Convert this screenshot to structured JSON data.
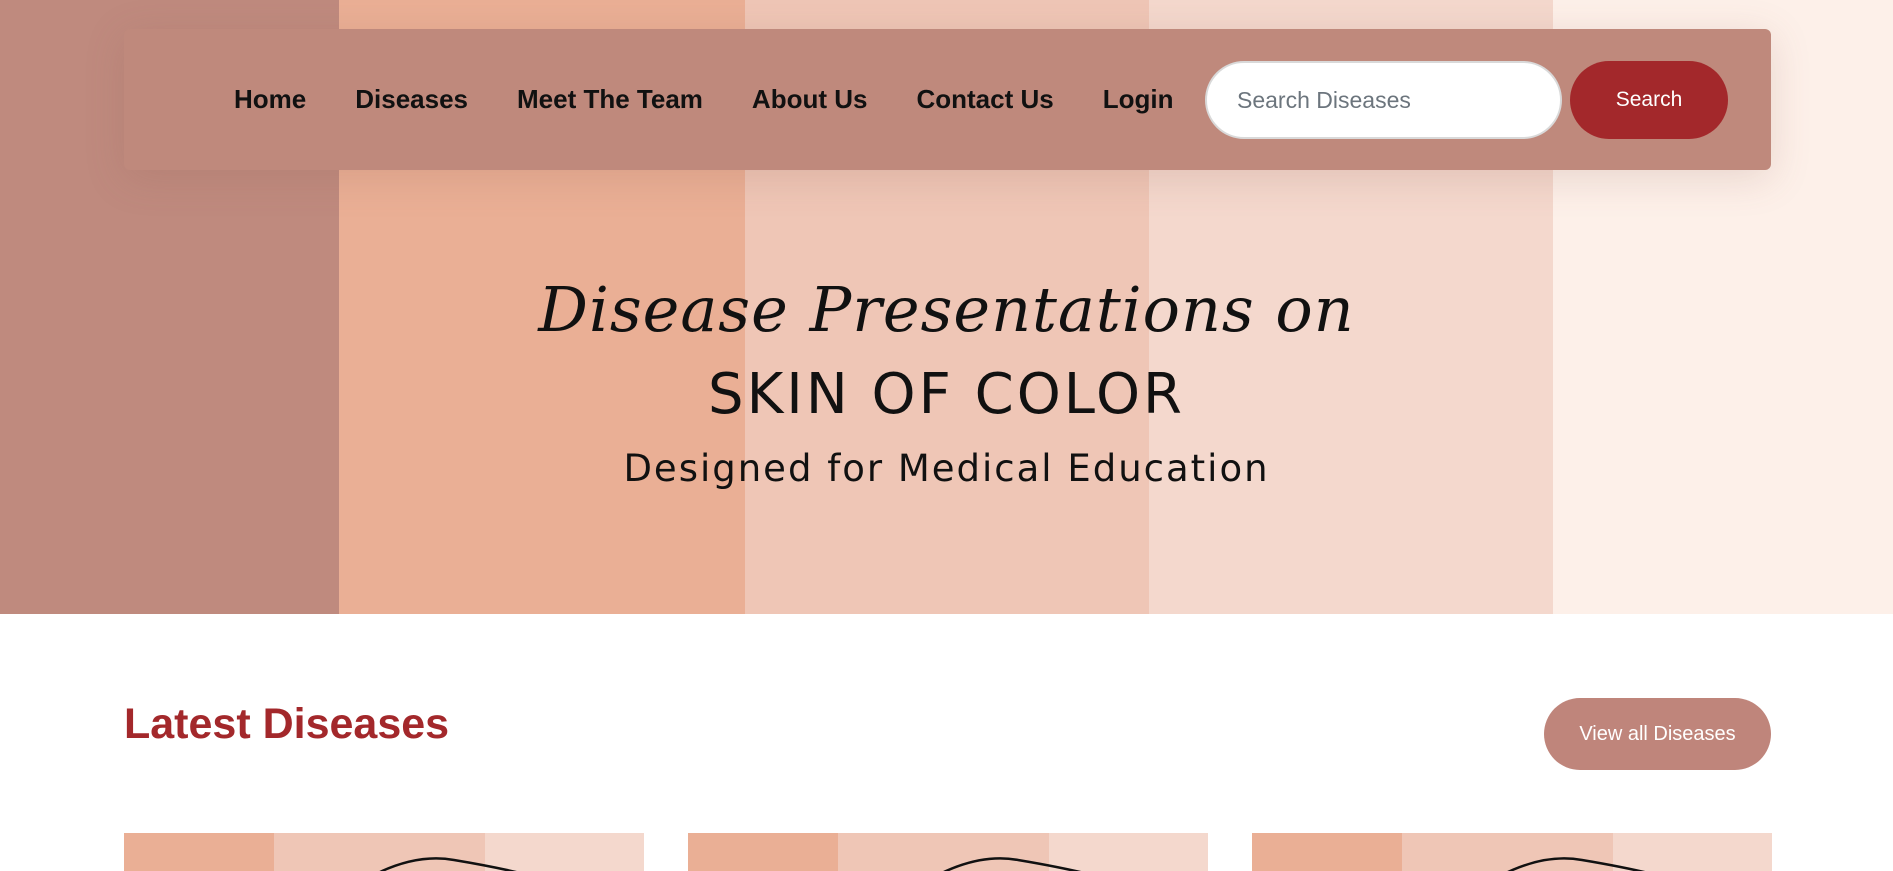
{
  "nav": {
    "items": [
      {
        "label": "Home"
      },
      {
        "label": "Diseases"
      },
      {
        "label": "Meet The Team"
      },
      {
        "label": "About Us"
      },
      {
        "label": "Contact Us"
      },
      {
        "label": "Login"
      }
    ],
    "search": {
      "placeholder": "Search Diseases",
      "value": "",
      "button_label": "Search"
    }
  },
  "hero": {
    "script_line": "Disease Presentations on",
    "title": "SKIN OF COLOR",
    "subtitle": "Designed for Medical Education"
  },
  "latest": {
    "heading": "Latest Diseases",
    "view_all_label": "View all Diseases"
  },
  "colors": {
    "accent": "#a3282b",
    "nav_bg": "#bf897c",
    "view_all_bg": "#bf857b",
    "skin_tones": [
      "#bf8a7e",
      "#eaaf95",
      "#efc6b6",
      "#f4d8cd",
      "#fdf0e9"
    ]
  }
}
